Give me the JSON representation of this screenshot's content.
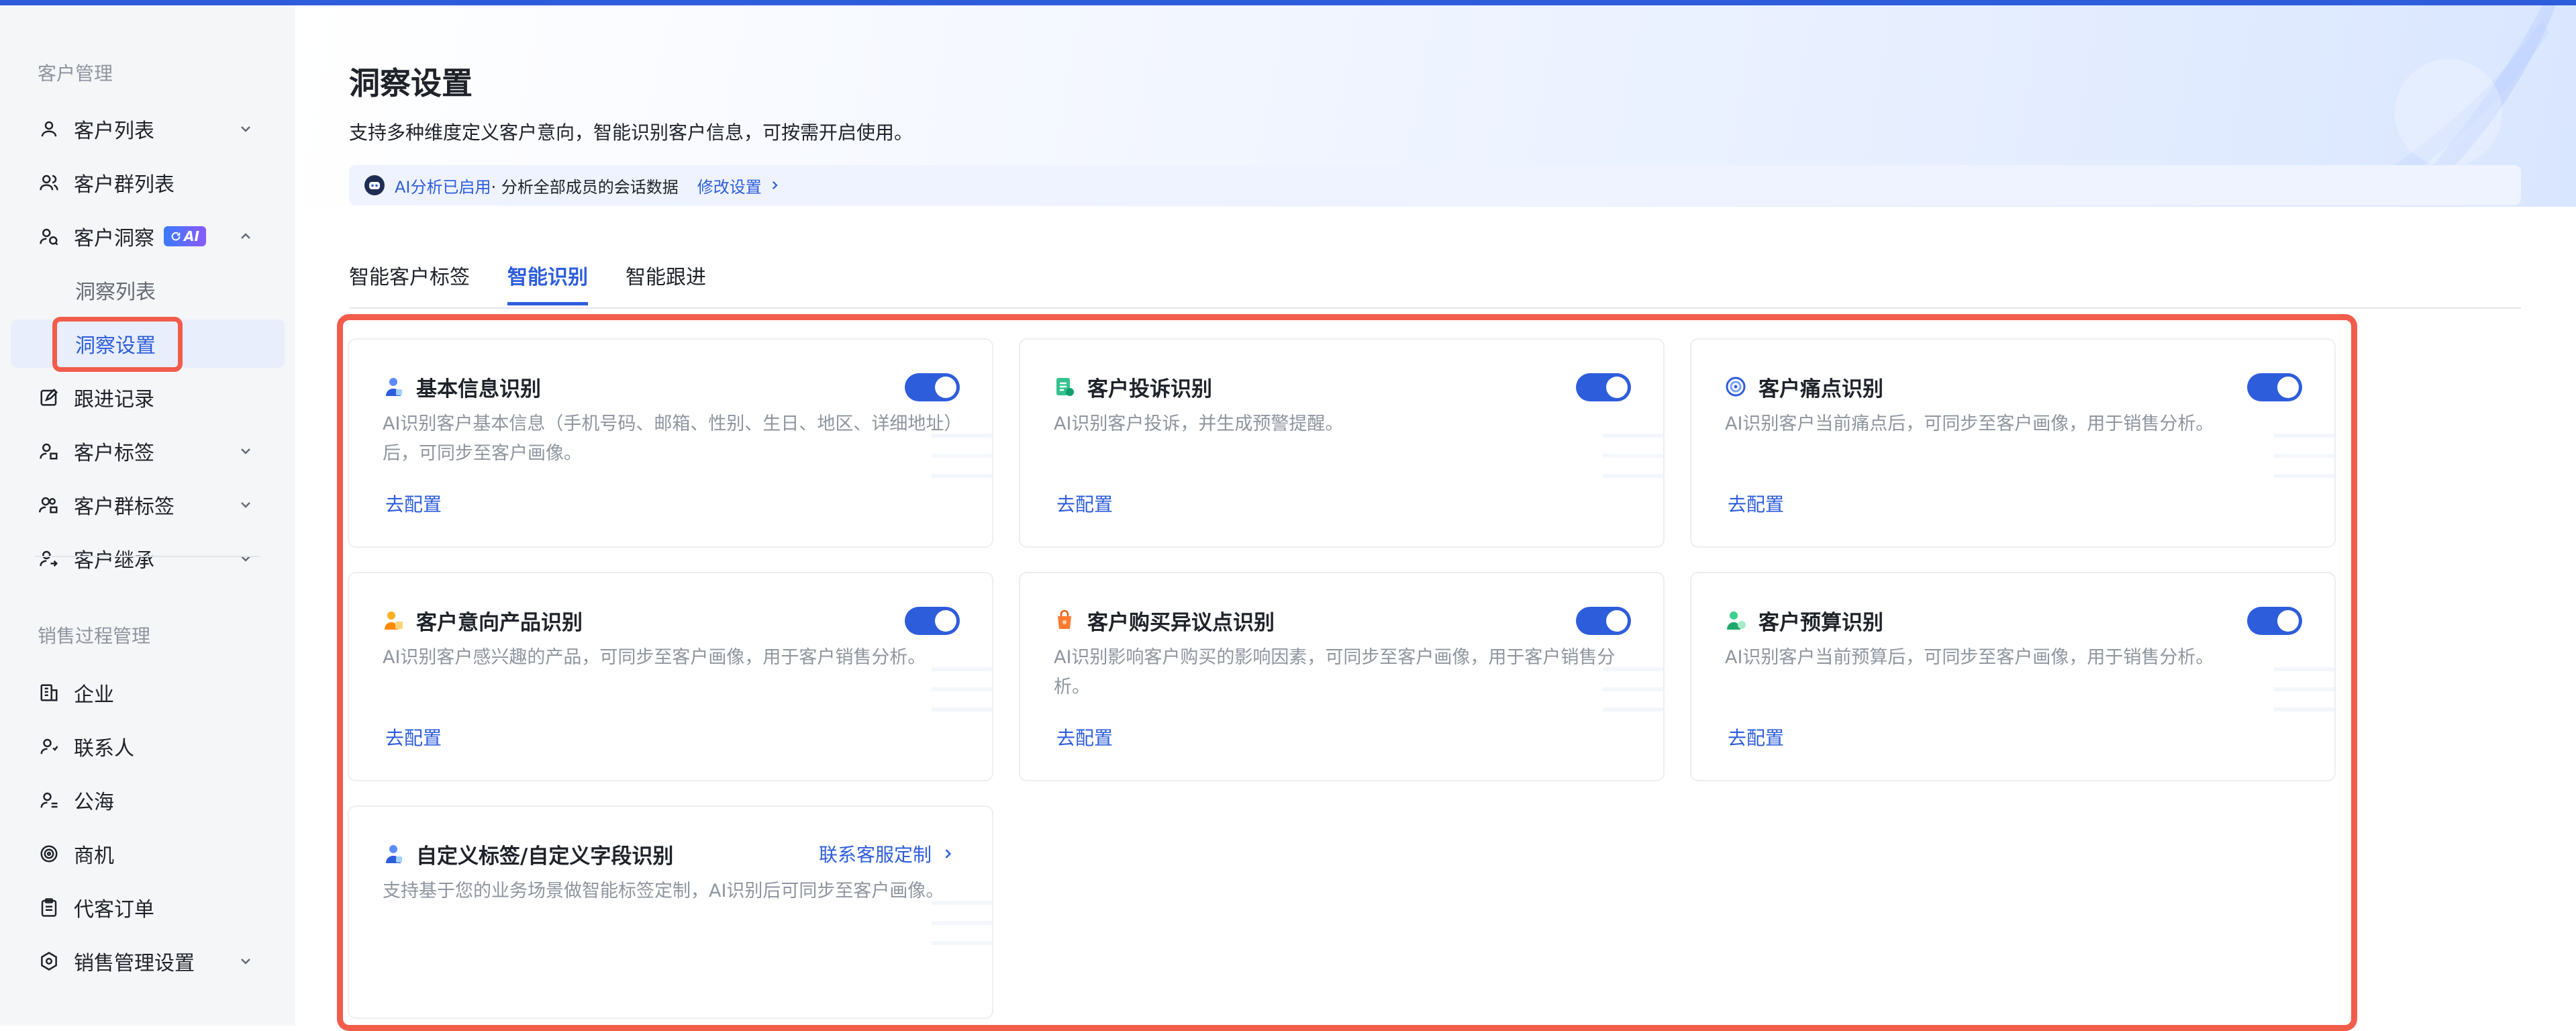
{
  "sidebar": {
    "section1": "客户管理",
    "items": [
      {
        "label": "客户列表"
      },
      {
        "label": "客户群列表"
      },
      {
        "label": "客户洞察",
        "badge": "AI"
      },
      {
        "label": "跟进记录"
      },
      {
        "label": "客户标签"
      },
      {
        "label": "客户群标签"
      },
      {
        "label": "客户继承"
      }
    ],
    "sub_items": [
      {
        "label": "洞察列表"
      },
      {
        "label": "洞察设置"
      }
    ],
    "section2": "销售过程管理",
    "items2": [
      {
        "label": "企业"
      },
      {
        "label": "联系人"
      },
      {
        "label": "公海"
      },
      {
        "label": "商机"
      },
      {
        "label": "代客订单"
      },
      {
        "label": "销售管理设置"
      }
    ]
  },
  "main": {
    "title": "洞察设置",
    "description": "支持多种维度定义客户意向，智能识别客户信息，可按需开启使用。",
    "banner": {
      "enabled": "AI分析已启用",
      "desc": " · 分析全部成员的会话数据",
      "link": "修改设置"
    },
    "tabs": [
      {
        "label": "智能客户标签"
      },
      {
        "label": "智能识别"
      },
      {
        "label": "智能跟进"
      }
    ],
    "cards": [
      {
        "title": "基本信息识别",
        "desc": "AI识别客户基本信息（手机号码、邮箱、性别、生日、地区、详细地址）后，可同步至客户画像。",
        "action": "去配置",
        "icon": "person-icon"
      },
      {
        "title": "客户投诉识别",
        "desc": "AI识别客户投诉，并生成预警提醒。",
        "action": "去配置",
        "icon": "document-icon"
      },
      {
        "title": "客户痛点识别",
        "desc": "AI识别客户当前痛点后，可同步至客户画像，用于销售分析。",
        "action": "去配置",
        "icon": "target-icon"
      },
      {
        "title": "客户意向产品识别",
        "desc": "AI识别客户感兴趣的产品，可同步至客户画像，用于客户销售分析。",
        "action": "去配置",
        "icon": "product-icon"
      },
      {
        "title": "客户购买异议点识别",
        "desc": "AI识别影响客户购买的影响因素，可同步至客户画像，用于客户销售分析。",
        "action": "去配置",
        "icon": "bag-icon"
      },
      {
        "title": "客户预算识别",
        "desc": "AI识别客户当前预算后，可同步至客户画像，用于销售分析。",
        "action": "去配置",
        "icon": "budget-icon"
      },
      {
        "title": "自定义标签/自定义字段识别",
        "desc": "支持基于您的业务场景做智能标签定制，AI识别后可同步至客户画像。",
        "link": "联系客服定制",
        "icon": "custom-icon"
      }
    ]
  },
  "colors": {
    "accent": "#2e5ddc",
    "highlight": "#f25c4b"
  }
}
